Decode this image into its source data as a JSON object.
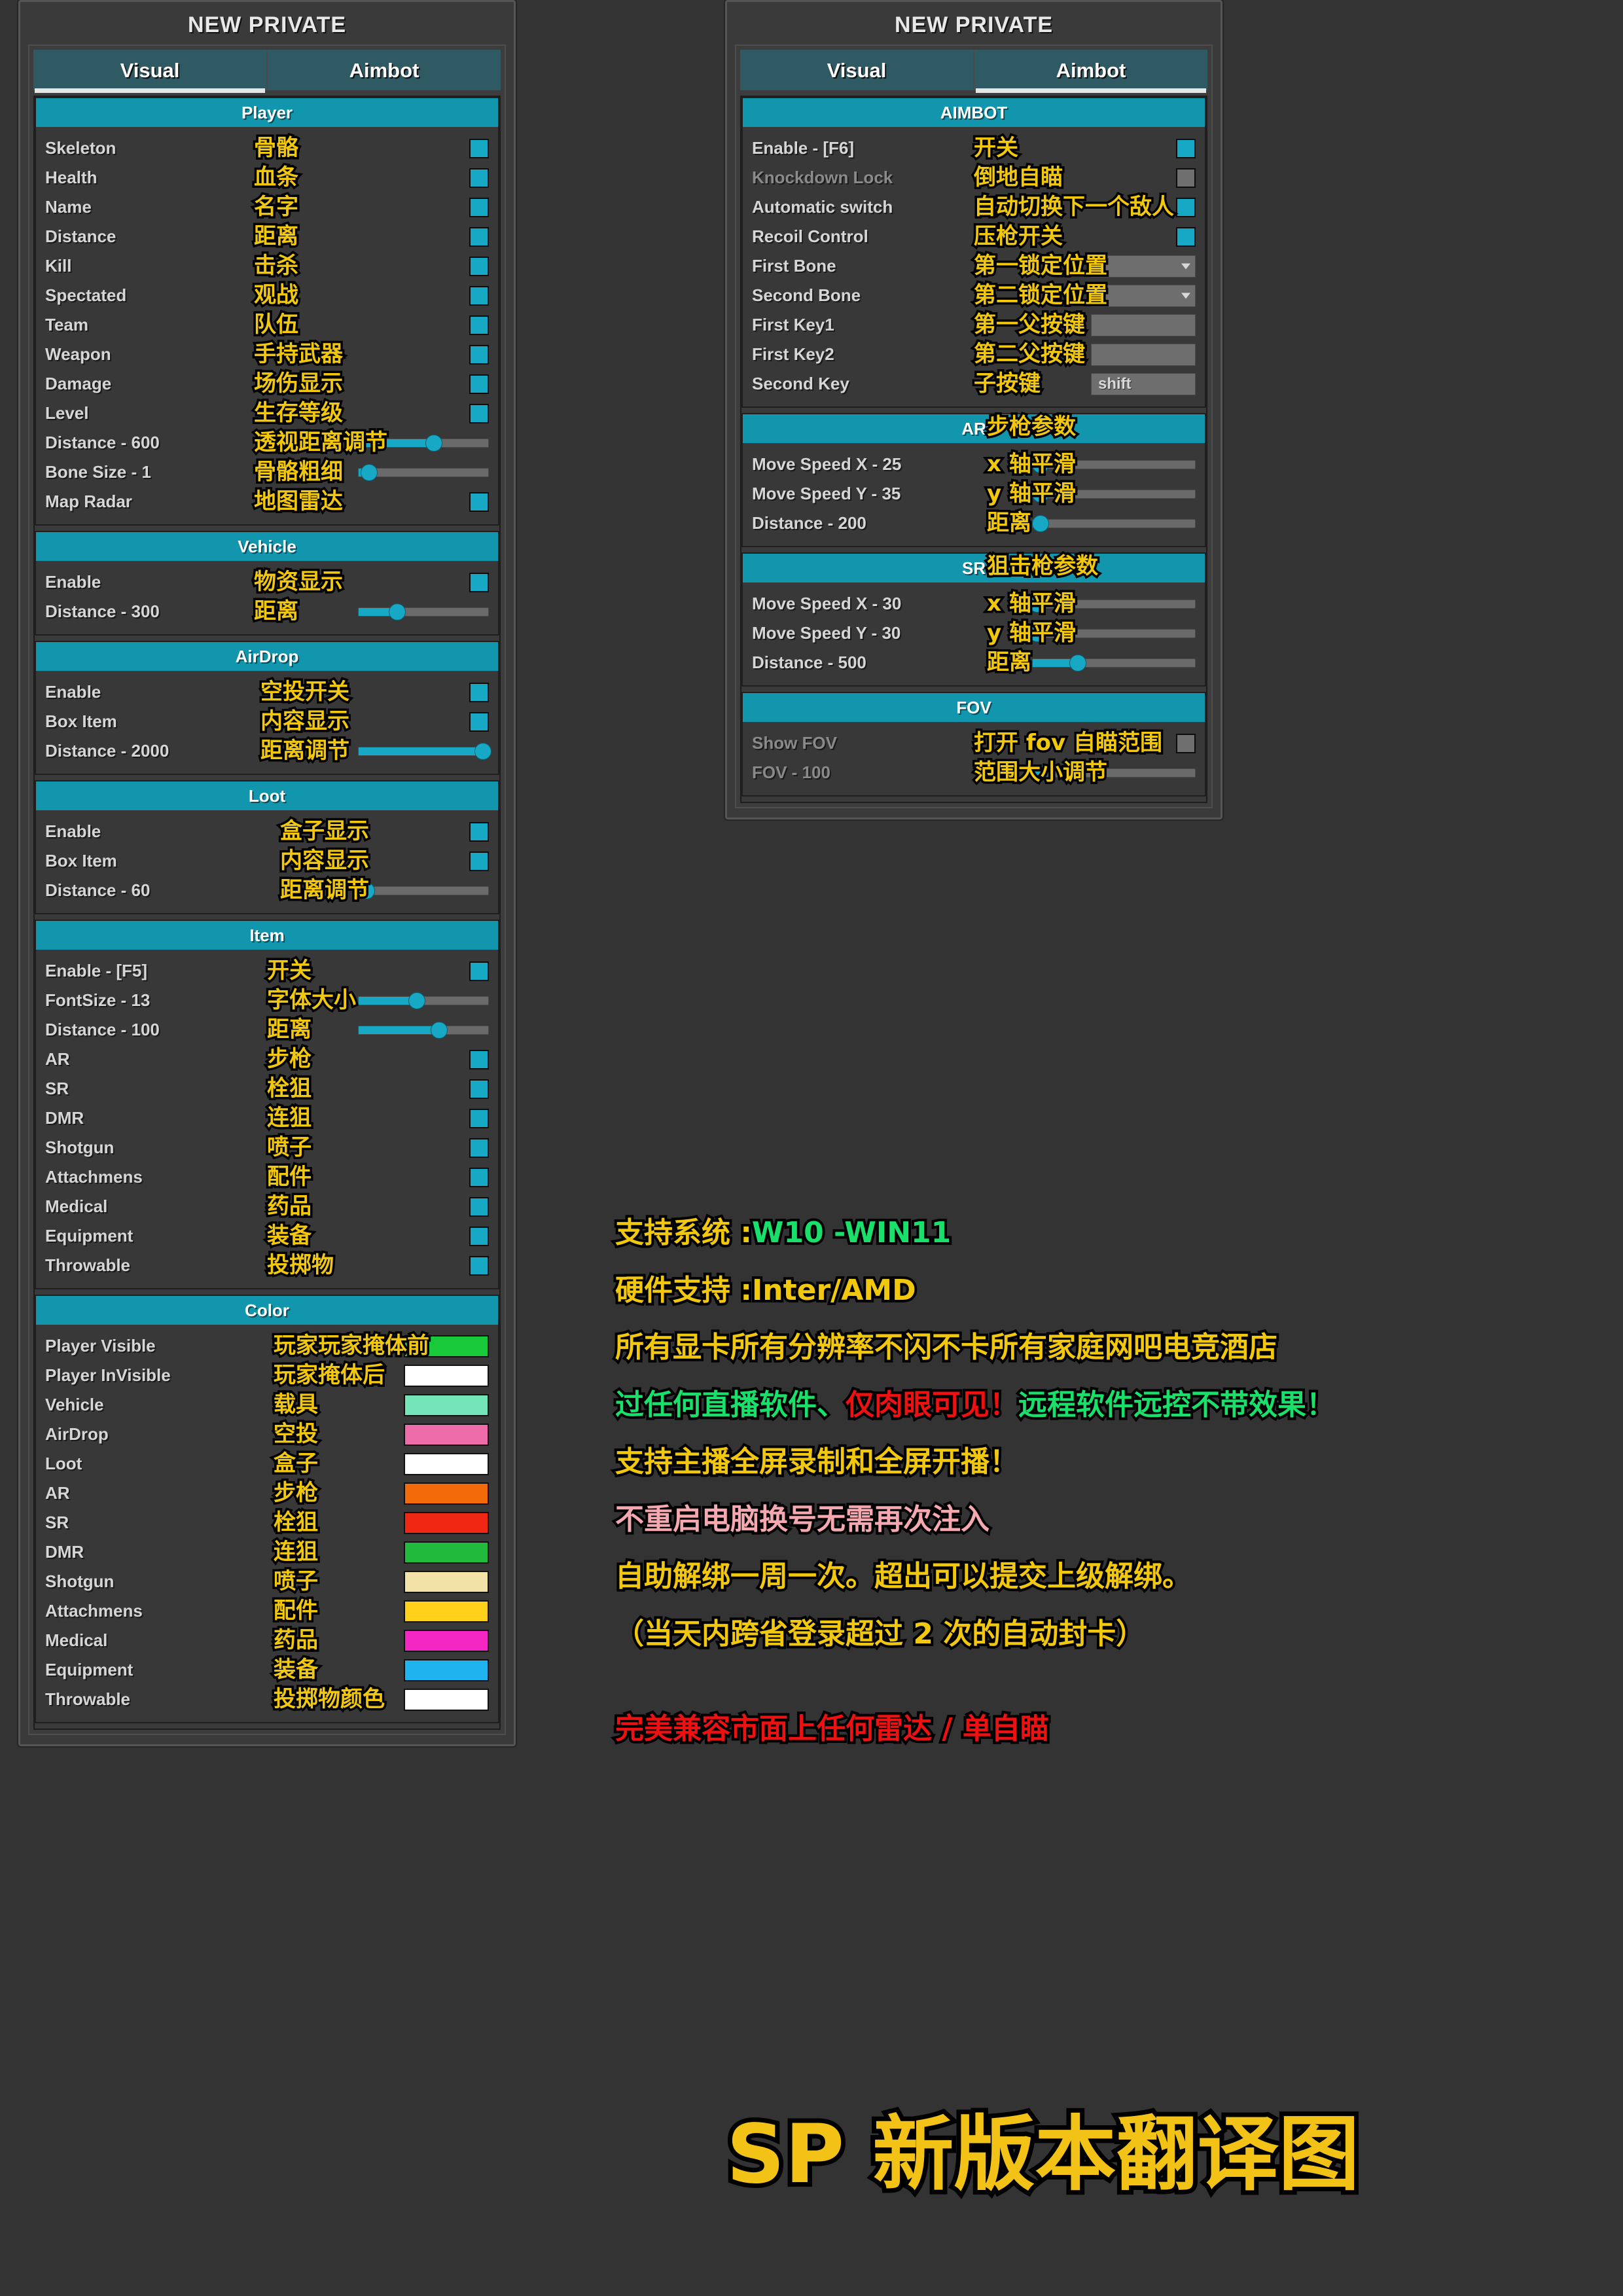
{
  "app": {
    "window_title": "NEW PRIVATE",
    "tabs": [
      "Visual",
      "Aimbot"
    ],
    "accent_color": "#1296ad",
    "checkbox_on_color": "#16a8c4",
    "annotation_color": "#f2c80f"
  },
  "left_panel": {
    "title": "NEW PRIVATE",
    "tabs": [
      {
        "label": "Visual",
        "active": true
      },
      {
        "label": "Aimbot",
        "active": false
      }
    ],
    "groups": [
      {
        "title": "Player",
        "rows": [
          {
            "label": "Skeleton",
            "cn": "骨骼",
            "type": "checkbox",
            "checked": true
          },
          {
            "label": "Health",
            "cn": "血条",
            "type": "checkbox",
            "checked": true
          },
          {
            "label": "Name",
            "cn": "名字",
            "type": "checkbox",
            "checked": true
          },
          {
            "label": "Distance",
            "cn": "距离",
            "type": "checkbox",
            "checked": true
          },
          {
            "label": "Kill",
            "cn": "击杀",
            "type": "checkbox",
            "checked": true
          },
          {
            "label": "Spectated",
            "cn": "观战",
            "type": "checkbox",
            "checked": true
          },
          {
            "label": "Team",
            "cn": "队伍",
            "type": "checkbox",
            "checked": true
          },
          {
            "label": "Weapon",
            "cn": "手持武器",
            "type": "checkbox",
            "checked": true
          },
          {
            "label": "Damage",
            "cn": "场伤显示",
            "type": "checkbox",
            "checked": true
          },
          {
            "label": "Level",
            "cn": "生存等级",
            "type": "checkbox",
            "checked": true
          },
          {
            "label": "Distance - 600",
            "cn": "透视距离调节",
            "type": "slider",
            "value": 600,
            "percent": 58
          },
          {
            "label": "Bone Size - 1",
            "cn": "骨骼粗细",
            "type": "slider",
            "value": 1,
            "percent": 8
          },
          {
            "label": "Map Radar",
            "cn": "地图雷达",
            "type": "checkbox",
            "checked": true
          }
        ]
      },
      {
        "title": "Vehicle",
        "rows": [
          {
            "label": "Enable",
            "cn": "物资显示",
            "type": "checkbox",
            "checked": true
          },
          {
            "label": "Distance - 300",
            "cn": "距离",
            "type": "slider",
            "value": 300,
            "percent": 30
          }
        ]
      },
      {
        "title": "AirDrop",
        "rows": [
          {
            "label": "Enable",
            "cn": "空投开关",
            "type": "checkbox",
            "checked": true
          },
          {
            "label": "Box Item",
            "cn": "内容显示",
            "type": "checkbox",
            "checked": true
          },
          {
            "label": "Distance - 2000",
            "cn": "距离调节",
            "type": "slider",
            "value": 2000,
            "percent": 96
          }
        ]
      },
      {
        "title": "Loot",
        "rows": [
          {
            "label": "Enable",
            "cn": "盒子显示",
            "type": "checkbox",
            "checked": true
          },
          {
            "label": "Box Item",
            "cn": "内容显示",
            "type": "checkbox",
            "checked": true
          },
          {
            "label": "Distance - 60",
            "cn": "距离调节",
            "type": "slider",
            "value": 60,
            "percent": 6
          }
        ]
      },
      {
        "title": "Item",
        "rows": [
          {
            "label": "Enable - [F5]",
            "cn": "开关",
            "type": "checkbox",
            "checked": true
          },
          {
            "label": "FontSize - 13",
            "cn": "字体大小",
            "type": "slider",
            "value": 13,
            "percent": 45
          },
          {
            "label": "Distance - 100",
            "cn": "距离",
            "type": "slider",
            "value": 100,
            "percent": 62
          },
          {
            "label": "AR",
            "cn": "步枪",
            "type": "checkbox",
            "checked": true
          },
          {
            "label": "SR",
            "cn": "栓狙",
            "type": "checkbox",
            "checked": true
          },
          {
            "label": "DMR",
            "cn": "连狙",
            "type": "checkbox",
            "checked": true
          },
          {
            "label": "Shotgun",
            "cn": "喷子",
            "type": "checkbox",
            "checked": true
          },
          {
            "label": "Attachmens",
            "cn": "配件",
            "type": "checkbox",
            "checked": true
          },
          {
            "label": "Medical",
            "cn": "药品",
            "type": "checkbox",
            "checked": true
          },
          {
            "label": "Equipment",
            "cn": "装备",
            "type": "checkbox",
            "checked": true
          },
          {
            "label": "Throwable",
            "cn": "投掷物",
            "type": "checkbox",
            "checked": true
          }
        ]
      },
      {
        "title": "Color",
        "rows": [
          {
            "label": "Player Visible",
            "cn": "玩家玩家掩体前",
            "type": "color",
            "color": "#18c93a"
          },
          {
            "label": "Player InVisible",
            "cn": "玩家掩体后",
            "type": "color",
            "color": "#ffffff"
          },
          {
            "label": "Vehicle",
            "cn": "载具",
            "type": "color",
            "color": "#74e5b8"
          },
          {
            "label": "AirDrop",
            "cn": "空投",
            "type": "color",
            "color": "#ef6cab"
          },
          {
            "label": "Loot",
            "cn": "盒子",
            "type": "color",
            "color": "#ffffff"
          },
          {
            "label": "AR",
            "cn": "步枪",
            "type": "color",
            "color": "#f26a0a"
          },
          {
            "label": "SR",
            "cn": "栓狙",
            "type": "color",
            "color": "#f02712"
          },
          {
            "label": "DMR",
            "cn": "连狙",
            "type": "color",
            "color": "#22ba3c"
          },
          {
            "label": "Shotgun",
            "cn": "喷子",
            "type": "color",
            "color": "#f2e2a8"
          },
          {
            "label": "Attachmens",
            "cn": "配件",
            "type": "color",
            "color": "#ffd11a"
          },
          {
            "label": "Medical",
            "cn": "药品",
            "type": "color",
            "color": "#f527c4"
          },
          {
            "label": "Equipment",
            "cn": "装备",
            "type": "color",
            "color": "#1fb3f0"
          },
          {
            "label": "Throwable",
            "cn": "投掷物颜色",
            "type": "color",
            "color": "#ffffff"
          }
        ]
      }
    ]
  },
  "right_panel": {
    "title": "NEW PRIVATE",
    "tabs": [
      {
        "label": "Visual",
        "active": false
      },
      {
        "label": "Aimbot",
        "active": true
      }
    ],
    "groups": [
      {
        "title": "AIMBOT",
        "rows": [
          {
            "label": "Enable - [F6]",
            "cn": "开关",
            "type": "checkbox",
            "checked": true,
            "dim": false
          },
          {
            "label": "Knockdown Lock",
            "cn": "倒地自瞄",
            "type": "checkbox",
            "checked": false,
            "dim": true
          },
          {
            "label": "Automatic switch",
            "cn": "自动切换下一个敌人",
            "type": "checkbox",
            "checked": true,
            "dim": false
          },
          {
            "label": "Recoil Control",
            "cn": "压枪开关",
            "type": "checkbox",
            "checked": true,
            "dim": false
          },
          {
            "label": "First Bone",
            "cn": "第一锁定位置",
            "type": "combo",
            "value": "",
            "dim": false
          },
          {
            "label": "Second Bone",
            "cn": "第二锁定位置",
            "type": "combo",
            "value": "",
            "dim": false
          },
          {
            "label": "First Key1",
            "cn": "第一父按键",
            "type": "keyfield",
            "value": "",
            "dim": false
          },
          {
            "label": "First Key2",
            "cn": "第二父按键",
            "type": "keyfield",
            "value": "",
            "dim": false
          },
          {
            "label": "Second Key",
            "cn": "子按键",
            "type": "keyfield",
            "value": "shift",
            "dim": false
          }
        ]
      },
      {
        "title": "AR",
        "title_cn": "步枪参数",
        "rows": [
          {
            "label": "Move Speed X - 25",
            "cn": "x 轴平滑",
            "type": "slider",
            "value": 25,
            "percent": 5
          },
          {
            "label": "Move Speed Y - 35",
            "cn": "y 轴平滑",
            "type": "slider",
            "value": 35,
            "percent": 5
          },
          {
            "label": "Distance - 200",
            "cn": "距离",
            "type": "slider",
            "value": 200,
            "percent": 5
          }
        ]
      },
      {
        "title": "SR",
        "title_cn": "狙击枪参数",
        "rows": [
          {
            "label": "Move Speed X - 30",
            "cn": "x 轴平滑",
            "type": "slider",
            "value": 30,
            "percent": 3
          },
          {
            "label": "Move Speed Y - 30",
            "cn": "y 轴平滑",
            "type": "slider",
            "value": 30,
            "percent": 3
          },
          {
            "label": "Distance - 500",
            "cn": "距离",
            "type": "slider",
            "value": 500,
            "percent": 28
          }
        ]
      },
      {
        "title": "FOV",
        "rows": [
          {
            "label": "Show FOV",
            "cn": "打开 fov 自瞄范围",
            "type": "checkbox",
            "checked": false,
            "dim": true
          },
          {
            "label": "FOV - 100",
            "cn": "范围大小调节",
            "type": "slider",
            "value": 100,
            "percent": 4,
            "dim": true
          }
        ]
      }
    ]
  },
  "promo": {
    "lines": [
      [
        {
          "text": "支持系统 :",
          "color": "yellow"
        },
        {
          "text": "W10 -WIN11",
          "color": "green"
        }
      ],
      [
        {
          "text": "硬件支持 :Inter/AMD",
          "color": "yellow"
        }
      ],
      [
        {
          "text": "所有显卡所有分辨率不闪不卡所有家庭网吧电竞酒店",
          "color": "yellow"
        }
      ],
      [
        {
          "text": "过任何直播软件、",
          "color": "green"
        },
        {
          "text": "仅肉眼可见！",
          "color": "red"
        },
        {
          "text": "远程软件远控不带效果！",
          "color": "green"
        }
      ],
      [
        {
          "text": "支持主播全屏录制和全屏开播！",
          "color": "yellow"
        }
      ],
      [
        {
          "text": "不重启电脑换号无需再次注入",
          "color": "pink"
        }
      ],
      [
        {
          "text": "自助解绑一周一次。超出可以提交上级解绑。",
          "color": "yellow"
        }
      ],
      [
        {
          "text": "（当天内跨省登录超过 2 次的自动封卡）",
          "color": "yellow"
        }
      ],
      [
        {
          "text": "",
          "color": "yellow"
        }
      ],
      [
        {
          "text": "完美兼容市面上任何雷达 / 单自瞄",
          "color": "red"
        }
      ]
    ],
    "big_title": "SP 新版本翻译图"
  }
}
